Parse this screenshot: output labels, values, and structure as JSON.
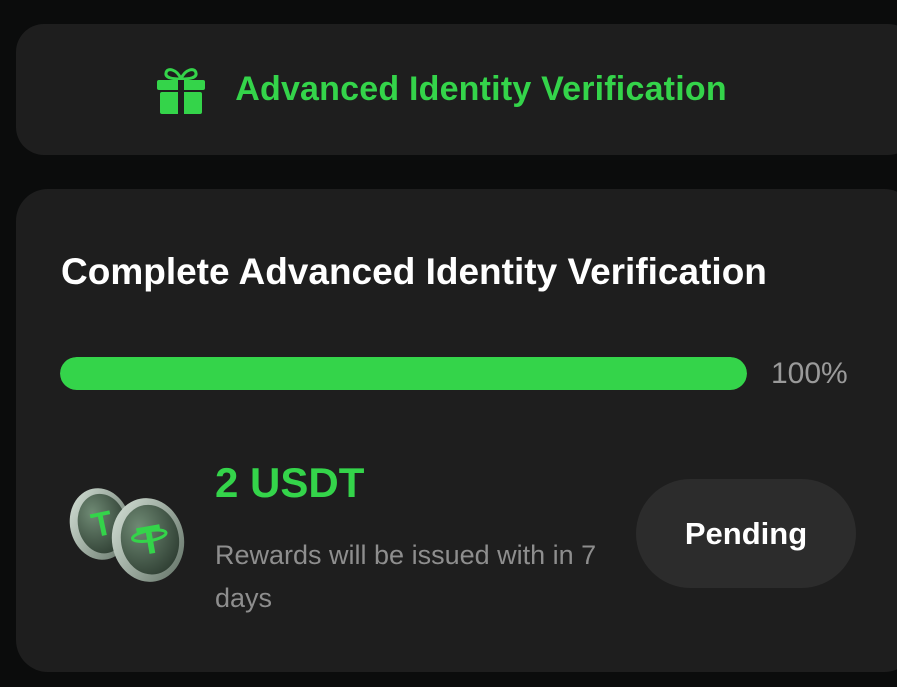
{
  "banner": {
    "icon": "gift-icon",
    "title": "Advanced Identity Verification"
  },
  "task": {
    "title": "Complete Advanced Identity Verification",
    "progress": 1.0,
    "progress_label": "100%",
    "reward_icon": "usdt-coins-icon",
    "reward_amount": "2 USDT",
    "reward_note": "Rewards will be issued with in 7 days",
    "status_button": "Pending"
  },
  "colors": {
    "accent": "#34d44a",
    "background": "#0b0c0c",
    "card": "#1e1e1e",
    "button": "#2c2c2c"
  }
}
